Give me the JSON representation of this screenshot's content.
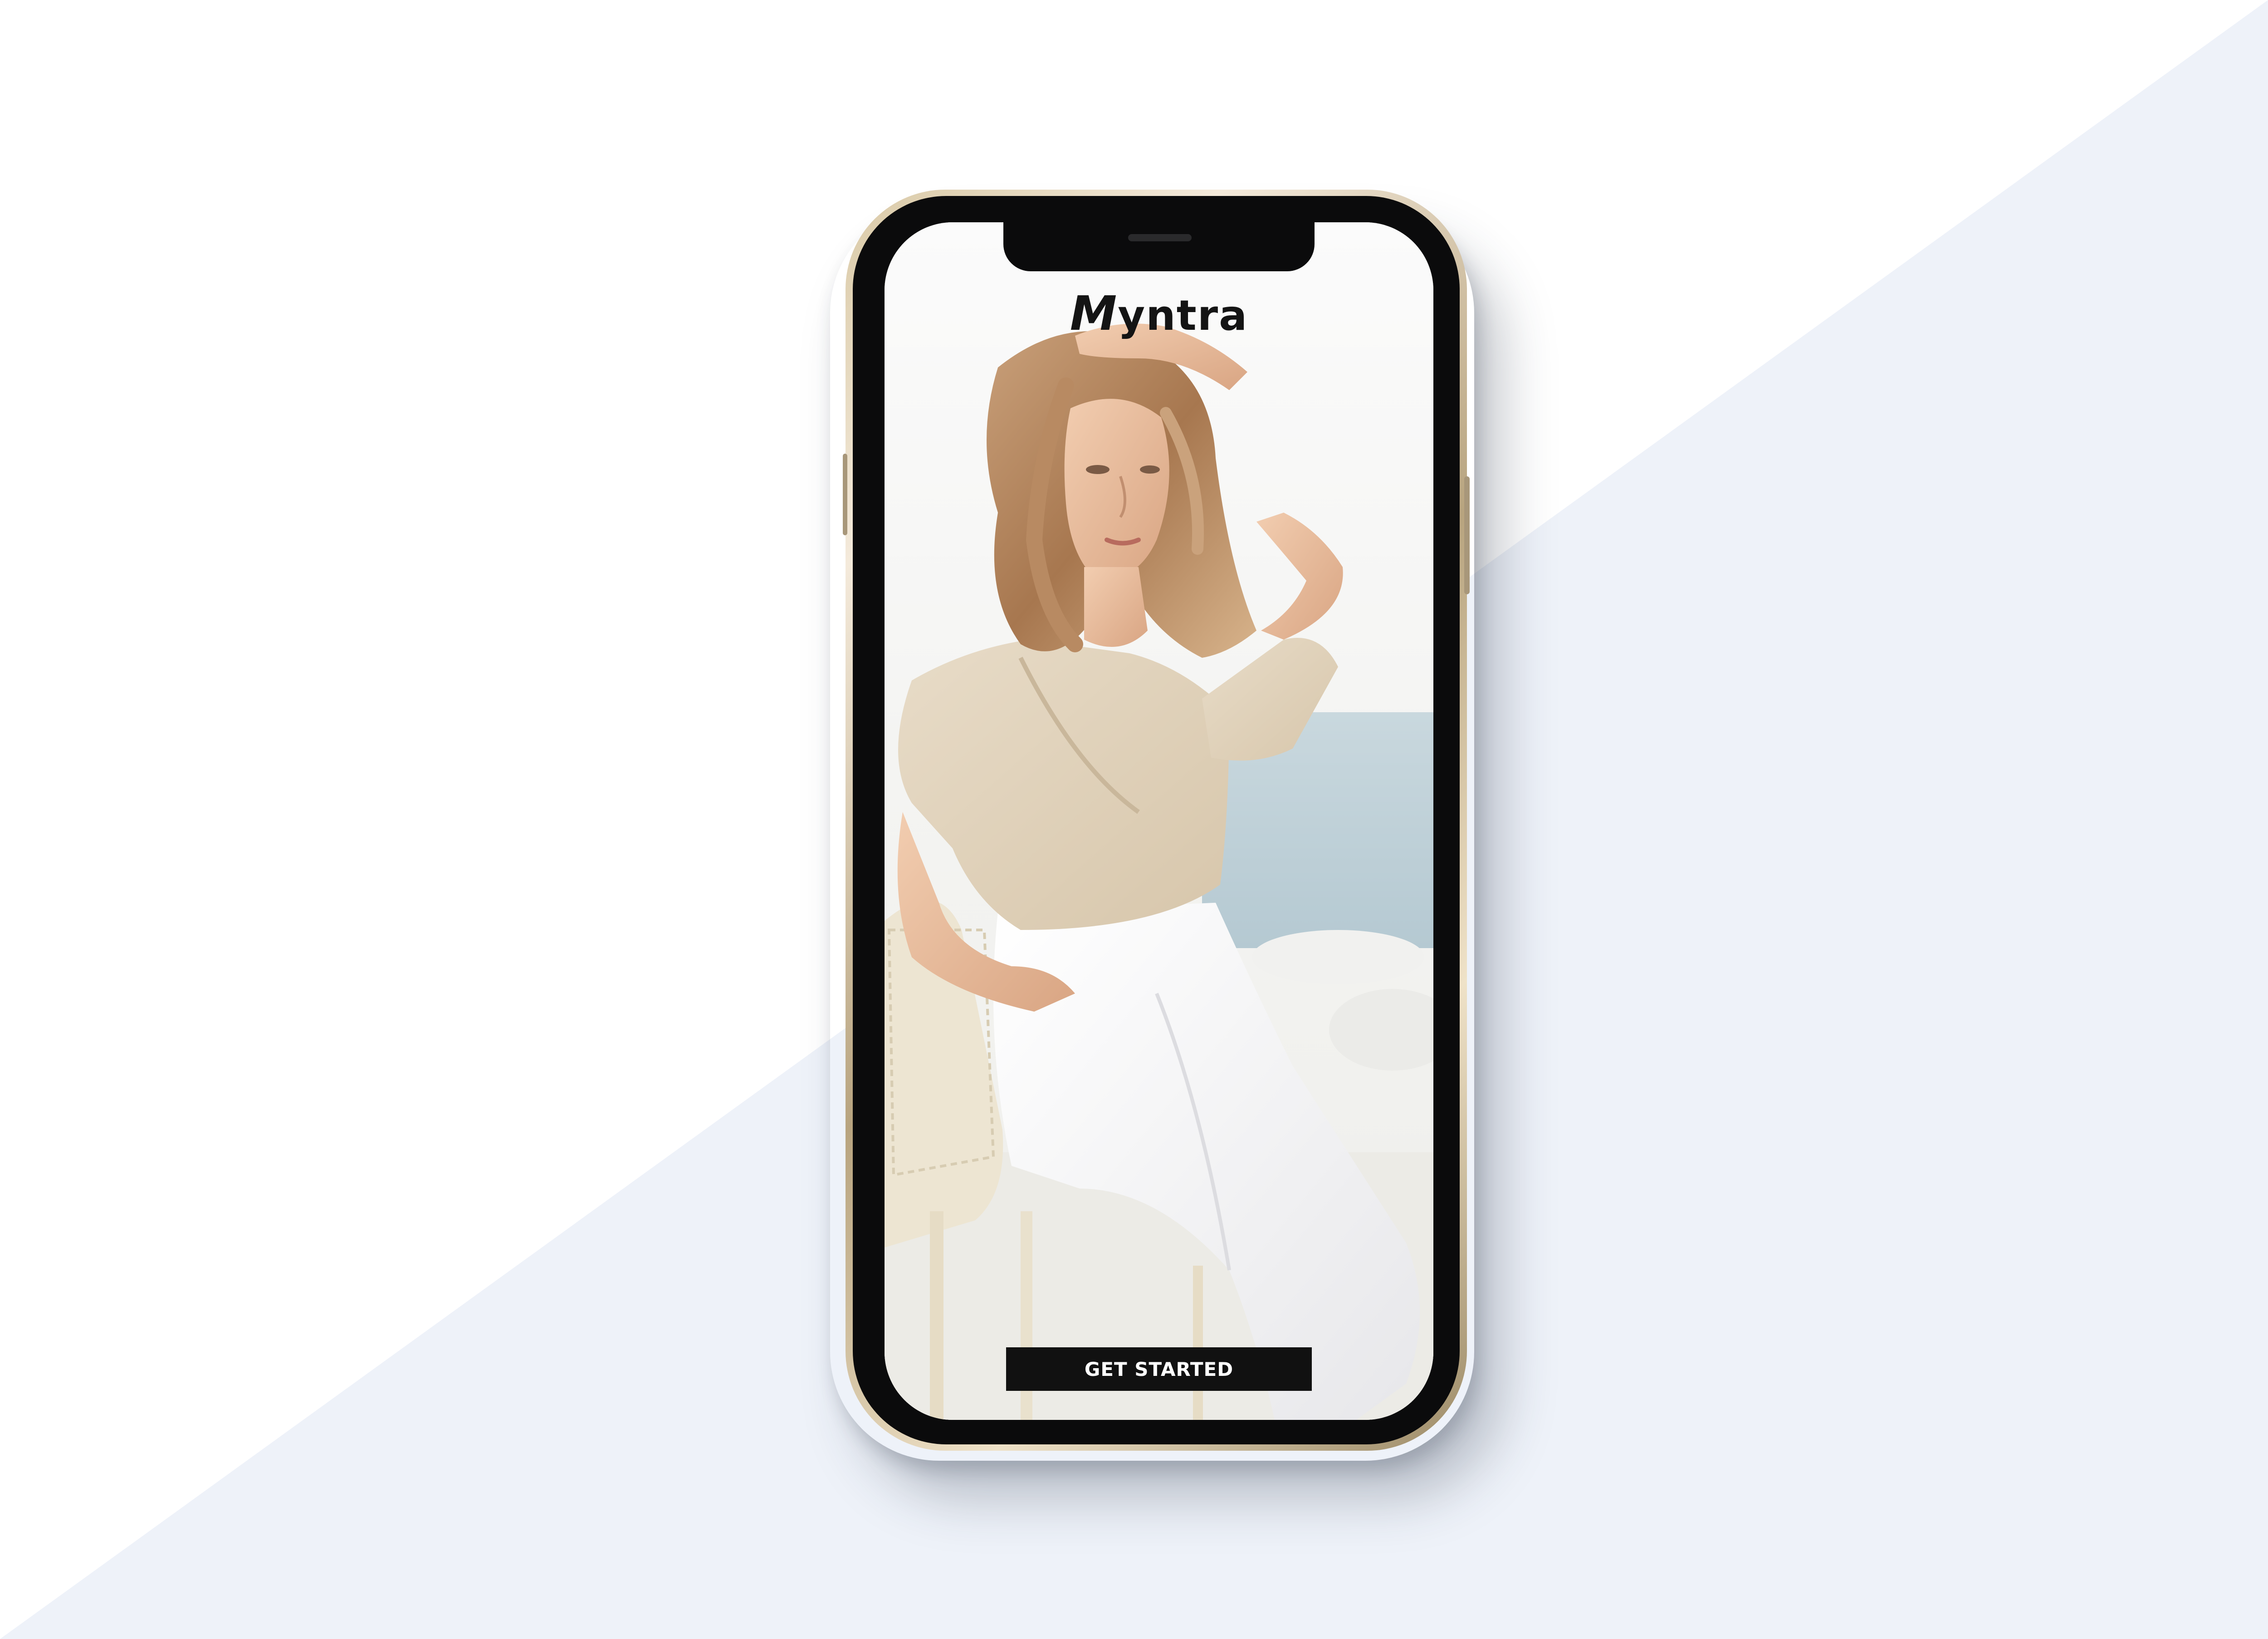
{
  "app": {
    "brand_first_letter": "M",
    "brand_rest": "yntra"
  },
  "cta": {
    "label": "GET STARTED"
  },
  "colors": {
    "background_light": "#ffffff",
    "background_band": "#eef2f9",
    "button_bg": "#111111",
    "button_text": "#ffffff",
    "phone_frame": "#c8b894"
  },
  "hero": {
    "icon": "woman-portrait-photo"
  }
}
